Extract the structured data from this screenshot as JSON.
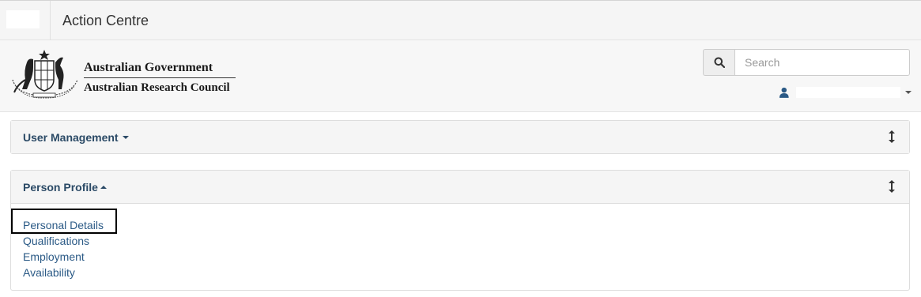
{
  "topbar": {
    "app_title": "Action Centre"
  },
  "header": {
    "org_line1": "Australian Government",
    "org_line2": "Australian Research Council",
    "search": {
      "placeholder": "Search",
      "icon": "search-icon"
    },
    "user_icon": "user-icon"
  },
  "panels": {
    "user_management": {
      "title": "User Management",
      "state": "collapsed"
    },
    "person_profile": {
      "title": "Person Profile",
      "state": "expanded",
      "links": [
        "Personal Details",
        "Qualifications",
        "Employment",
        "Availability"
      ]
    }
  },
  "colors": {
    "panel_title": "#2b4a66",
    "link": "#2b5a86",
    "panel_heading_bg": "#f5f5f5",
    "user_icon": "#2b5a86"
  }
}
